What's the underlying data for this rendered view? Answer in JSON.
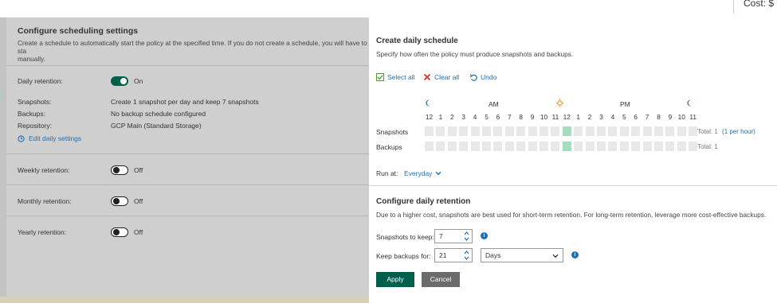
{
  "topbar": {
    "cost_label": "Cost: $"
  },
  "left_panel": {
    "title": "Configure scheduling settings",
    "description": "Create a schedule to automatically start the policy at the specified time. If you do not create a schedule, you will have to sta\nmanually.",
    "daily": {
      "label": "Daily retention:",
      "state": "On"
    },
    "details": [
      {
        "label": "Snapshots:",
        "value": "Create 1 snapshot per day and keep 7 snapshots"
      },
      {
        "label": "Backups:",
        "value": "No backup schedule configured"
      },
      {
        "label": "Repository:",
        "value": "GCP Main (Standard Storage)"
      }
    ],
    "edit_link": "Edit daily settings",
    "weekly": {
      "label": "Weekly retention:",
      "state": "Off"
    },
    "monthly": {
      "label": "Monthly retention:",
      "state": "Off"
    },
    "yearly": {
      "label": "Yearly retention:",
      "state": "Off"
    }
  },
  "right_panel": {
    "schedule_title": "Create daily schedule",
    "schedule_desc": "Specify how often the policy must produce snapshots and backups.",
    "actions": {
      "select_all": "Select all",
      "clear_all": "Clear all",
      "undo": "Undo"
    },
    "am_label": "AM",
    "pm_label": "PM",
    "hours": [
      "12",
      "1",
      "2",
      "3",
      "4",
      "5",
      "6",
      "7",
      "8",
      "9",
      "10",
      "11",
      "12",
      "1",
      "2",
      "3",
      "4",
      "5",
      "6",
      "7",
      "8",
      "9",
      "10",
      "11"
    ],
    "rows": {
      "snapshots": {
        "label": "Snapshots",
        "selected_hours": [
          12
        ],
        "total": "Total: 1",
        "per_hour": "(1 per hour)"
      },
      "backups": {
        "label": "Backups",
        "selected_hours": [
          12
        ],
        "total": "Total: 1"
      }
    },
    "run_at": {
      "label": "Run at:",
      "value": "Everyday"
    },
    "retention_title": "Configure daily retention",
    "retention_desc": "Due to a higher cost, snapshots are best used for short-term retention. For long-term retention, leverage more cost-effective backups.",
    "snapshots_to_keep": {
      "label": "Snapshots to keep:",
      "value": "7"
    },
    "keep_backups_for": {
      "label": "Keep backups for:",
      "value": "21",
      "unit": "Days"
    },
    "apply_label": "Apply",
    "cancel_label": "Cancel"
  },
  "colors": {
    "accent": "#005f4b",
    "link": "#1f6fb2",
    "selected_cell": "#a7dcc1",
    "cell": "#e8e8e8"
  }
}
